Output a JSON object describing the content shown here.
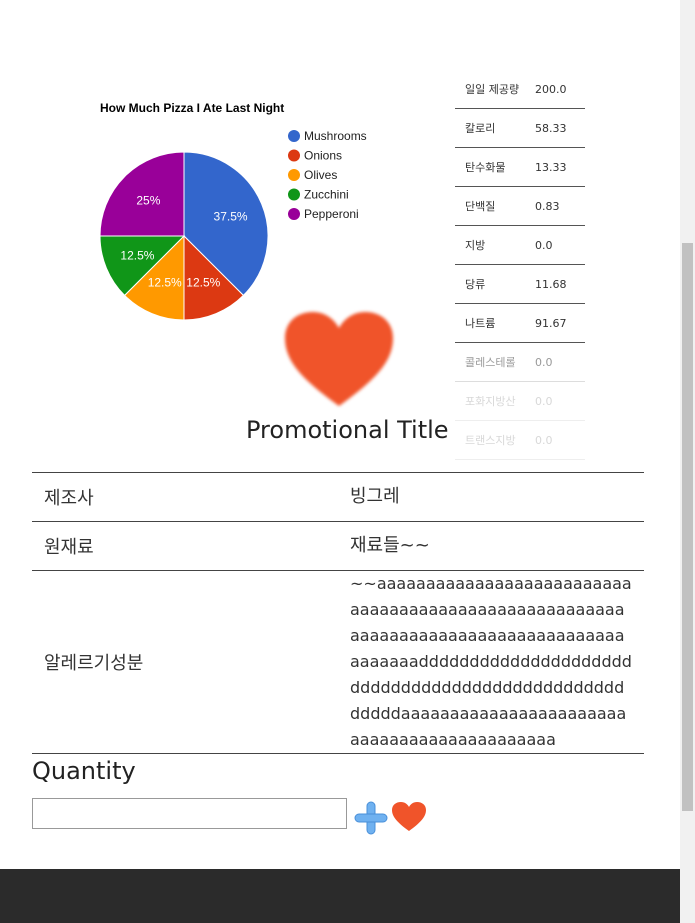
{
  "chart_data": {
    "type": "pie",
    "title": "How Much Pizza I Ate Last Night",
    "slices": [
      {
        "label": "Mushrooms",
        "value": 3,
        "percent_label": "37.5%",
        "color": "#3366cc"
      },
      {
        "label": "Onions",
        "value": 1,
        "percent_label": "12.5%",
        "color": "#dc3912"
      },
      {
        "label": "Olives",
        "value": 1,
        "percent_label": "12.5%",
        "color": "#ff9900"
      },
      {
        "label": "Zucchini",
        "value": 1,
        "percent_label": "12.5%",
        "color": "#109618"
      },
      {
        "label": "Pepperoni",
        "value": 2,
        "percent_label": "25%",
        "color": "#990099"
      }
    ],
    "legend_position": "right"
  },
  "nutrition": [
    {
      "label": "일일 제공량",
      "value": "200.0"
    },
    {
      "label": "칼로리",
      "value": "58.33"
    },
    {
      "label": "탄수화물",
      "value": "13.33"
    },
    {
      "label": "단백질",
      "value": "0.83"
    },
    {
      "label": "지방",
      "value": "0.0"
    },
    {
      "label": "당류",
      "value": "11.68"
    },
    {
      "label": "나트륨",
      "value": "91.67"
    },
    {
      "label": "콜레스테롤",
      "value": "0.0"
    },
    {
      "label": "포화지방산",
      "value": "0.0"
    },
    {
      "label": "트랜스지방",
      "value": "0.0"
    }
  ],
  "promo": {
    "title": "Promotional Title",
    "heart_icon": "heart-icon"
  },
  "info_table": [
    {
      "key": "제조사",
      "value": "빙그레"
    },
    {
      "key": "원재료",
      "value": "재료들~~"
    },
    {
      "key": "알레르기성분",
      "value": "~~aaaaaaaaaaaaaaaaaaaaaaaaaaaaaaaaaaaaaaaaaaaaaaaaaaaaaaaaaaaaaaaaaaaaaaaaaaaaaaaaaaaaaaaaadddddddddddddddddddddddddddddddddddddddddddddddddddddaaaaaaaaaaaaaaaaaaaaaaaaaaaaaaaaaaaaaaaaaaaa"
    }
  ],
  "quantity": {
    "label": "Quantity",
    "value": "",
    "plus_icon": "plus-icon",
    "heart_icon": "heart-icon"
  },
  "colors": {
    "heart": "#f0542a",
    "plus": "#6fb1f0",
    "footer": "#2b2b2b"
  }
}
